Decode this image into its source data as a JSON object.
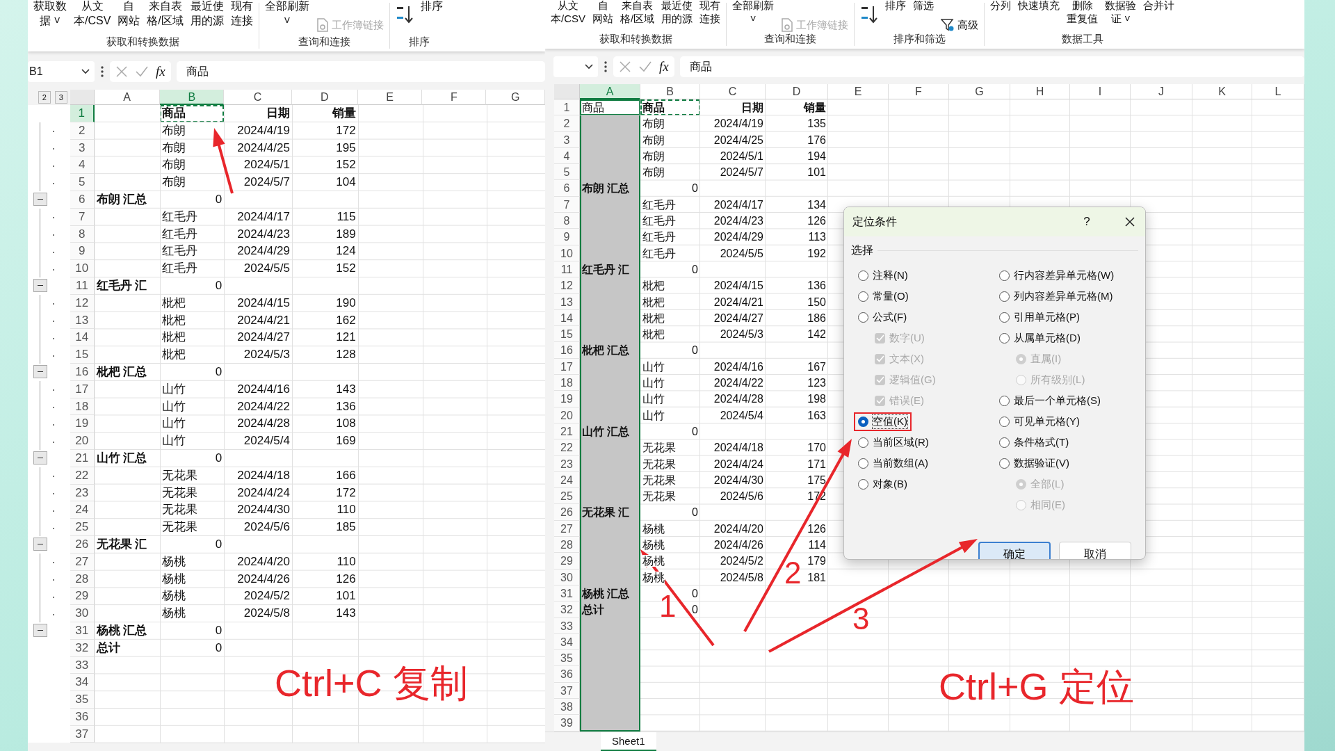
{
  "left_window": {
    "ribbon": [
      {
        "label": "获取和转换数据",
        "items": [
          {
            "kind": "large",
            "lines": [
              "获取数",
              "据 ˅"
            ],
            "disabled": false
          },
          {
            "kind": "large",
            "lines": [
              "从文",
              "本/CSV"
            ],
            "disabled": false
          },
          {
            "kind": "large",
            "lines": [
              "自",
              "网站"
            ],
            "disabled": false
          },
          {
            "kind": "large",
            "lines": [
              "来自表",
              "格/区域"
            ],
            "disabled": false
          },
          {
            "kind": "large",
            "lines": [
              "最近使",
              "用的源"
            ],
            "disabled": false
          },
          {
            "kind": "large",
            "lines": [
              "现有",
              "连接"
            ],
            "disabled": false
          }
        ]
      },
      {
        "label": "查询和连接",
        "items": [
          {
            "kind": "large",
            "lines": [
              "全部刷新",
              "˅"
            ],
            "disabled": false
          },
          {
            "kind": "link",
            "label": "工作簿链接",
            "disabled": true
          }
        ]
      },
      {
        "label": "排序",
        "items": [
          {
            "kind": "sort",
            "disabled": false
          },
          {
            "kind": "large",
            "lines": [
              "排序"
            ],
            "disabled": false
          }
        ]
      }
    ],
    "formula_bar": {
      "name_box": "B1",
      "function_label": "fx",
      "formula": "商品"
    },
    "outline_levels": [
      "2",
      "3"
    ],
    "columns": [
      {
        "label": "A",
        "selected": false,
        "copied": false,
        "range_selected": false
      },
      {
        "label": "B",
        "selected": true,
        "copied": true,
        "range_selected": false
      },
      {
        "label": "C",
        "selected": false,
        "copied": false,
        "range_selected": false
      },
      {
        "label": "D",
        "selected": false,
        "copied": false,
        "range_selected": false
      },
      {
        "label": "E",
        "selected": false,
        "copied": false,
        "range_selected": false
      },
      {
        "label": "F",
        "selected": false,
        "copied": false,
        "range_selected": false
      },
      {
        "label": "G",
        "selected": false,
        "copied": false,
        "range_selected": false
      }
    ],
    "rows": [
      {
        "number": "1",
        "kind": "header",
        "selected": true,
        "copied": true,
        "cells": [
          "",
          "商品",
          "日期",
          "销量"
        ]
      },
      {
        "number": "2",
        "kind": "data",
        "selected": false,
        "copied": false,
        "cells": [
          "",
          "布朗",
          "2024/4/19",
          "172"
        ]
      },
      {
        "number": "3",
        "kind": "data",
        "selected": false,
        "copied": false,
        "cells": [
          "",
          "布朗",
          "2024/4/25",
          "195"
        ]
      },
      {
        "number": "4",
        "kind": "data",
        "selected": false,
        "copied": false,
        "cells": [
          "",
          "布朗",
          "2024/5/1",
          "152"
        ]
      },
      {
        "number": "5",
        "kind": "data",
        "selected": false,
        "copied": false,
        "cells": [
          "",
          "布朗",
          "2024/5/7",
          "104"
        ]
      },
      {
        "number": "6",
        "kind": "subtotal",
        "selected": false,
        "copied": false,
        "cells": [
          "布朗 汇总",
          "0"
        ]
      },
      {
        "number": "7",
        "kind": "data",
        "selected": false,
        "copied": false,
        "cells": [
          "",
          "红毛丹",
          "2024/4/17",
          "115"
        ]
      },
      {
        "number": "8",
        "kind": "data",
        "selected": false,
        "copied": false,
        "cells": [
          "",
          "红毛丹",
          "2024/4/23",
          "189"
        ]
      },
      {
        "number": "9",
        "kind": "data",
        "selected": false,
        "copied": false,
        "cells": [
          "",
          "红毛丹",
          "2024/4/29",
          "124"
        ]
      },
      {
        "number": "10",
        "kind": "data",
        "selected": false,
        "copied": false,
        "cells": [
          "",
          "红毛丹",
          "2024/5/5",
          "152"
        ]
      },
      {
        "number": "11",
        "kind": "subtotal",
        "selected": false,
        "copied": false,
        "cells": [
          "红毛丹 汇",
          "0"
        ]
      },
      {
        "number": "12",
        "kind": "data",
        "selected": false,
        "copied": false,
        "cells": [
          "",
          "枇杷",
          "2024/4/15",
          "190"
        ]
      },
      {
        "number": "13",
        "kind": "data",
        "selected": false,
        "copied": false,
        "cells": [
          "",
          "枇杷",
          "2024/4/21",
          "162"
        ]
      },
      {
        "number": "14",
        "kind": "data",
        "selected": false,
        "copied": false,
        "cells": [
          "",
          "枇杷",
          "2024/4/27",
          "121"
        ]
      },
      {
        "number": "15",
        "kind": "data",
        "selected": false,
        "copied": false,
        "cells": [
          "",
          "枇杷",
          "2024/5/3",
          "128"
        ]
      },
      {
        "number": "16",
        "kind": "subtotal",
        "selected": false,
        "copied": false,
        "cells": [
          "枇杷 汇总",
          "0"
        ]
      },
      {
        "number": "17",
        "kind": "data",
        "selected": false,
        "copied": false,
        "cells": [
          "",
          "山竹",
          "2024/4/16",
          "143"
        ]
      },
      {
        "number": "18",
        "kind": "data",
        "selected": false,
        "copied": false,
        "cells": [
          "",
          "山竹",
          "2024/4/22",
          "136"
        ]
      },
      {
        "number": "19",
        "kind": "data",
        "selected": false,
        "copied": false,
        "cells": [
          "",
          "山竹",
          "2024/4/28",
          "108"
        ]
      },
      {
        "number": "20",
        "kind": "data",
        "selected": false,
        "copied": false,
        "cells": [
          "",
          "山竹",
          "2024/5/4",
          "169"
        ]
      },
      {
        "number": "21",
        "kind": "subtotal",
        "selected": false,
        "copied": false,
        "cells": [
          "山竹 汇总",
          "0"
        ]
      },
      {
        "number": "22",
        "kind": "data",
        "selected": false,
        "copied": false,
        "cells": [
          "",
          "无花果",
          "2024/4/18",
          "166"
        ]
      },
      {
        "number": "23",
        "kind": "data",
        "selected": false,
        "copied": false,
        "cells": [
          "",
          "无花果",
          "2024/4/24",
          "172"
        ]
      },
      {
        "number": "24",
        "kind": "data",
        "selected": false,
        "copied": false,
        "cells": [
          "",
          "无花果",
          "2024/4/30",
          "110"
        ]
      },
      {
        "number": "25",
        "kind": "data",
        "selected": false,
        "copied": false,
        "cells": [
          "",
          "无花果",
          "2024/5/6",
          "185"
        ]
      },
      {
        "number": "26",
        "kind": "subtotal",
        "selected": false,
        "copied": false,
        "cells": [
          "无花果 汇",
          "0"
        ]
      },
      {
        "number": "27",
        "kind": "data",
        "selected": false,
        "copied": false,
        "cells": [
          "",
          "杨桃",
          "2024/4/20",
          "110"
        ]
      },
      {
        "number": "28",
        "kind": "data",
        "selected": false,
        "copied": false,
        "cells": [
          "",
          "杨桃",
          "2024/4/26",
          "126"
        ]
      },
      {
        "number": "29",
        "kind": "data",
        "selected": false,
        "copied": false,
        "cells": [
          "",
          "杨桃",
          "2024/5/2",
          "101"
        ]
      },
      {
        "number": "30",
        "kind": "data",
        "selected": false,
        "copied": false,
        "cells": [
          "",
          "杨桃",
          "2024/5/8",
          "143"
        ]
      },
      {
        "number": "31",
        "kind": "subtotal",
        "selected": false,
        "copied": false,
        "cells": [
          "杨桃 汇总",
          "0"
        ]
      },
      {
        "number": "32",
        "kind": "total",
        "selected": false,
        "copied": false,
        "cells": [
          "总计",
          "0"
        ]
      },
      {
        "number": "33",
        "kind": "blank",
        "selected": false,
        "copied": false,
        "cells": []
      },
      {
        "number": "34",
        "kind": "blank",
        "selected": false,
        "copied": false,
        "cells": []
      },
      {
        "number": "35",
        "kind": "blank",
        "selected": false,
        "copied": false,
        "cells": []
      },
      {
        "number": "36",
        "kind": "blank",
        "selected": false,
        "copied": false,
        "cells": []
      },
      {
        "number": "37",
        "kind": "blank",
        "selected": false,
        "copied": false,
        "cells": []
      }
    ]
  },
  "right_window": {
    "ribbon": [
      {
        "label": "获取和转换数据",
        "items": [
          {
            "kind": "large",
            "lines": [
              "从文",
              "本/CSV"
            ],
            "disabled": false
          },
          {
            "kind": "large",
            "lines": [
              "自",
              "网站"
            ],
            "disabled": false
          },
          {
            "kind": "large",
            "lines": [
              "来自表",
              "格/区域"
            ],
            "disabled": false
          },
          {
            "kind": "large",
            "lines": [
              "最近使",
              "用的源"
            ],
            "disabled": false
          },
          {
            "kind": "large",
            "lines": [
              "现有",
              "连接"
            ],
            "disabled": false
          }
        ]
      },
      {
        "label": "查询和连接",
        "items": [
          {
            "kind": "large",
            "lines": [
              "全部刷新",
              "˅"
            ],
            "disabled": false
          },
          {
            "kind": "link",
            "label": "工作簿链接",
            "disabled": true
          }
        ]
      },
      {
        "label": "排序和筛选",
        "items": [
          {
            "kind": "sort",
            "disabled": false
          },
          {
            "kind": "large",
            "lines": [
              "排序"
            ],
            "disabled": false
          },
          {
            "kind": "large",
            "lines": [
              "筛选"
            ],
            "disabled": false
          },
          {
            "kind": "filter",
            "label": "高级",
            "disabled": false
          }
        ]
      },
      {
        "label": "数据工具",
        "items": [
          {
            "kind": "large",
            "lines": [
              "分列"
            ],
            "disabled": false
          },
          {
            "kind": "large",
            "lines": [
              "快速填充"
            ],
            "disabled": false
          },
          {
            "kind": "large",
            "lines": [
              "删除",
              "重复值"
            ],
            "disabled": false
          },
          {
            "kind": "large",
            "lines": [
              "数据验",
              "证 ˅"
            ],
            "disabled": false
          },
          {
            "kind": "large",
            "lines": [
              "合并计"
            ],
            "disabled": false
          }
        ]
      }
    ],
    "formula_bar": {
      "function_label": "fx",
      "formula": "商品"
    },
    "columns": [
      {
        "label": "A",
        "selected": true,
        "copied": false,
        "range_selected": true
      },
      {
        "label": "B",
        "selected": false,
        "copied": true,
        "range_selected": false
      },
      {
        "label": "C",
        "selected": false,
        "copied": false,
        "range_selected": false
      },
      {
        "label": "D",
        "selected": false,
        "copied": false,
        "range_selected": false
      },
      {
        "label": "E",
        "selected": false,
        "copied": false,
        "range_selected": false
      },
      {
        "label": "F",
        "selected": false,
        "copied": false,
        "range_selected": false
      },
      {
        "label": "G",
        "selected": false,
        "copied": false,
        "range_selected": false
      },
      {
        "label": "H",
        "selected": false,
        "copied": false,
        "range_selected": false
      },
      {
        "label": "I",
        "selected": false,
        "copied": false,
        "range_selected": false
      },
      {
        "label": "J",
        "selected": false,
        "copied": false,
        "range_selected": false
      },
      {
        "label": "K",
        "selected": false,
        "copied": false,
        "range_selected": false
      },
      {
        "label": "L",
        "selected": false,
        "copied": false,
        "range_selected": false
      }
    ],
    "rows": [
      {
        "number": "1",
        "kind": "header",
        "selected": false,
        "copied": true,
        "cells": [
          "商品",
          "商品",
          "日期",
          "销量"
        ]
      },
      {
        "number": "2",
        "kind": "data",
        "selected": false,
        "copied": false,
        "cells": [
          "",
          "布朗",
          "2024/4/19",
          "135"
        ]
      },
      {
        "number": "3",
        "kind": "data",
        "selected": false,
        "copied": false,
        "cells": [
          "",
          "布朗",
          "2024/4/25",
          "176"
        ]
      },
      {
        "number": "4",
        "kind": "data",
        "selected": false,
        "copied": false,
        "cells": [
          "",
          "布朗",
          "2024/5/1",
          "194"
        ]
      },
      {
        "number": "5",
        "kind": "data",
        "selected": false,
        "copied": false,
        "cells": [
          "",
          "布朗",
          "2024/5/7",
          "101"
        ]
      },
      {
        "number": "6",
        "kind": "subtotal",
        "selected": false,
        "copied": false,
        "cells": [
          "布朗 汇总",
          "0"
        ]
      },
      {
        "number": "7",
        "kind": "data",
        "selected": false,
        "copied": false,
        "cells": [
          "",
          "红毛丹",
          "2024/4/17",
          "134"
        ]
      },
      {
        "number": "8",
        "kind": "data",
        "selected": false,
        "copied": false,
        "cells": [
          "",
          "红毛丹",
          "2024/4/23",
          "126"
        ]
      },
      {
        "number": "9",
        "kind": "data",
        "selected": false,
        "copied": false,
        "cells": [
          "",
          "红毛丹",
          "2024/4/29",
          "113"
        ]
      },
      {
        "number": "10",
        "kind": "data",
        "selected": false,
        "copied": false,
        "cells": [
          "",
          "红毛丹",
          "2024/5/5",
          "192"
        ]
      },
      {
        "number": "11",
        "kind": "subtotal",
        "selected": false,
        "copied": false,
        "cells": [
          "红毛丹 汇",
          "0"
        ]
      },
      {
        "number": "12",
        "kind": "data",
        "selected": false,
        "copied": false,
        "cells": [
          "",
          "枇杷",
          "2024/4/15",
          "136"
        ]
      },
      {
        "number": "13",
        "kind": "data",
        "selected": false,
        "copied": false,
        "cells": [
          "",
          "枇杷",
          "2024/4/21",
          "150"
        ]
      },
      {
        "number": "14",
        "kind": "data",
        "selected": false,
        "copied": false,
        "cells": [
          "",
          "枇杷",
          "2024/4/27",
          "186"
        ]
      },
      {
        "number": "15",
        "kind": "data",
        "selected": false,
        "copied": false,
        "cells": [
          "",
          "枇杷",
          "2024/5/3",
          "142"
        ]
      },
      {
        "number": "16",
        "kind": "subtotal",
        "selected": false,
        "copied": false,
        "cells": [
          "枇杷 汇总",
          "0"
        ]
      },
      {
        "number": "17",
        "kind": "data",
        "selected": false,
        "copied": false,
        "cells": [
          "",
          "山竹",
          "2024/4/16",
          "167"
        ]
      },
      {
        "number": "18",
        "kind": "data",
        "selected": false,
        "copied": false,
        "cells": [
          "",
          "山竹",
          "2024/4/22",
          "123"
        ]
      },
      {
        "number": "19",
        "kind": "data",
        "selected": false,
        "copied": false,
        "cells": [
          "",
          "山竹",
          "2024/4/28",
          "198"
        ]
      },
      {
        "number": "20",
        "kind": "data",
        "selected": false,
        "copied": false,
        "cells": [
          "",
          "山竹",
          "2024/5/4",
          "163"
        ]
      },
      {
        "number": "21",
        "kind": "subtotal",
        "selected": false,
        "copied": false,
        "cells": [
          "山竹 汇总",
          "0"
        ]
      },
      {
        "number": "22",
        "kind": "data",
        "selected": false,
        "copied": false,
        "cells": [
          "",
          "无花果",
          "2024/4/18",
          "170"
        ]
      },
      {
        "number": "23",
        "kind": "data",
        "selected": false,
        "copied": false,
        "cells": [
          "",
          "无花果",
          "2024/4/24",
          "171"
        ]
      },
      {
        "number": "24",
        "kind": "data",
        "selected": false,
        "copied": false,
        "cells": [
          "",
          "无花果",
          "2024/4/30",
          "175"
        ]
      },
      {
        "number": "25",
        "kind": "data",
        "selected": false,
        "copied": false,
        "cells": [
          "",
          "无花果",
          "2024/5/6",
          "172"
        ]
      },
      {
        "number": "26",
        "kind": "subtotal",
        "selected": false,
        "copied": false,
        "cells": [
          "无花果 汇",
          "0"
        ]
      },
      {
        "number": "27",
        "kind": "data",
        "selected": false,
        "copied": false,
        "cells": [
          "",
          "杨桃",
          "2024/4/20",
          "126"
        ]
      },
      {
        "number": "28",
        "kind": "data",
        "selected": false,
        "copied": false,
        "cells": [
          "",
          "杨桃",
          "2024/4/26",
          "114"
        ]
      },
      {
        "number": "29",
        "kind": "data",
        "selected": false,
        "copied": false,
        "cells": [
          "",
          "杨桃",
          "2024/5/2",
          "179"
        ]
      },
      {
        "number": "30",
        "kind": "data",
        "selected": false,
        "copied": false,
        "cells": [
          "",
          "杨桃",
          "2024/5/8",
          "181"
        ]
      },
      {
        "number": "31",
        "kind": "subtotal",
        "selected": false,
        "copied": false,
        "cells": [
          "杨桃 汇总",
          "0"
        ]
      },
      {
        "number": "32",
        "kind": "total",
        "selected": false,
        "copied": false,
        "cells": [
          "总计",
          "0"
        ]
      },
      {
        "number": "33",
        "kind": "blank",
        "selected": false,
        "copied": false,
        "cells": []
      },
      {
        "number": "34",
        "kind": "blank",
        "selected": false,
        "copied": false,
        "cells": []
      },
      {
        "number": "35",
        "kind": "blank",
        "selected": false,
        "copied": false,
        "cells": []
      },
      {
        "number": "36",
        "kind": "blank",
        "selected": false,
        "copied": false,
        "cells": []
      },
      {
        "number": "37",
        "kind": "blank",
        "selected": false,
        "copied": false,
        "cells": []
      },
      {
        "number": "38",
        "kind": "blank",
        "selected": false,
        "copied": false,
        "cells": []
      },
      {
        "number": "39",
        "kind": "blank",
        "selected": false,
        "copied": false,
        "cells": []
      }
    ],
    "sheet_tabs": [
      {
        "label": "Sheet1",
        "selected": true
      }
    ]
  },
  "dialog": {
    "title": "定位条件",
    "help": "?",
    "section": "选择",
    "left_options": [
      {
        "label": "注释(N)",
        "kind": "radio",
        "selected": false,
        "disabled": false,
        "highlighted": false
      },
      {
        "label": "常量(O)",
        "kind": "radio",
        "selected": false,
        "disabled": false,
        "highlighted": false
      },
      {
        "label": "公式(F)",
        "kind": "radio",
        "selected": false,
        "disabled": false,
        "highlighted": false
      },
      {
        "label": "数字(U)",
        "kind": "check",
        "checked": true,
        "disabled": true,
        "highlighted": false
      },
      {
        "label": "文本(X)",
        "kind": "check",
        "checked": true,
        "disabled": true,
        "highlighted": false
      },
      {
        "label": "逻辑值(G)",
        "kind": "check",
        "checked": true,
        "disabled": true,
        "highlighted": false
      },
      {
        "label": "错误(E)",
        "kind": "check",
        "checked": true,
        "disabled": true,
        "highlighted": false
      },
      {
        "label": "空值(K)",
        "kind": "radio",
        "selected": true,
        "disabled": false,
        "highlighted": true
      },
      {
        "label": "当前区域(R)",
        "kind": "radio",
        "selected": false,
        "disabled": false,
        "highlighted": false
      },
      {
        "label": "当前数组(A)",
        "kind": "radio",
        "selected": false,
        "disabled": false,
        "highlighted": false
      },
      {
        "label": "对象(B)",
        "kind": "radio",
        "selected": false,
        "disabled": false,
        "highlighted": false
      }
    ],
    "right_options": [
      {
        "label": "行内容差异单元格(W)",
        "kind": "radio",
        "selected": false,
        "disabled": false,
        "highlighted": false
      },
      {
        "label": "列内容差异单元格(M)",
        "kind": "radio",
        "selected": false,
        "disabled": false,
        "highlighted": false
      },
      {
        "label": "引用单元格(P)",
        "kind": "radio",
        "selected": false,
        "disabled": false,
        "highlighted": false
      },
      {
        "label": "从属单元格(D)",
        "kind": "radio",
        "selected": false,
        "disabled": false,
        "highlighted": false
      },
      {
        "label": "直属(I)",
        "kind": "subradio",
        "selected": true,
        "disabled": true,
        "highlighted": false
      },
      {
        "label": "所有级别(L)",
        "kind": "subradio",
        "selected": false,
        "disabled": true,
        "highlighted": false
      },
      {
        "label": "最后一个单元格(S)",
        "kind": "radio",
        "selected": false,
        "disabled": false,
        "highlighted": false
      },
      {
        "label": "可见单元格(Y)",
        "kind": "radio",
        "selected": false,
        "disabled": false,
        "highlighted": false
      },
      {
        "label": "条件格式(T)",
        "kind": "radio",
        "selected": false,
        "disabled": false,
        "highlighted": false
      },
      {
        "label": "数据验证(V)",
        "kind": "radio",
        "selected": false,
        "disabled": false,
        "highlighted": false
      },
      {
        "label": "全部(L)",
        "kind": "subradio",
        "selected": true,
        "disabled": true,
        "highlighted": false
      },
      {
        "label": "相同(E)",
        "kind": "subradio",
        "selected": false,
        "disabled": true,
        "highlighted": false
      }
    ],
    "buttons": [
      {
        "label": "确定",
        "default": true
      },
      {
        "label": "取消",
        "default": false
      }
    ]
  },
  "annotations": {
    "arrows": [
      {
        "kind": "plain"
      },
      {
        "kind": "numbered",
        "label": "1"
      },
      {
        "kind": "numbered",
        "label": "2"
      },
      {
        "kind": "numbered",
        "label": "3"
      }
    ],
    "captions": [
      {
        "text": "Ctrl+C 复制"
      },
      {
        "text": "Ctrl+G 定位"
      }
    ]
  }
}
